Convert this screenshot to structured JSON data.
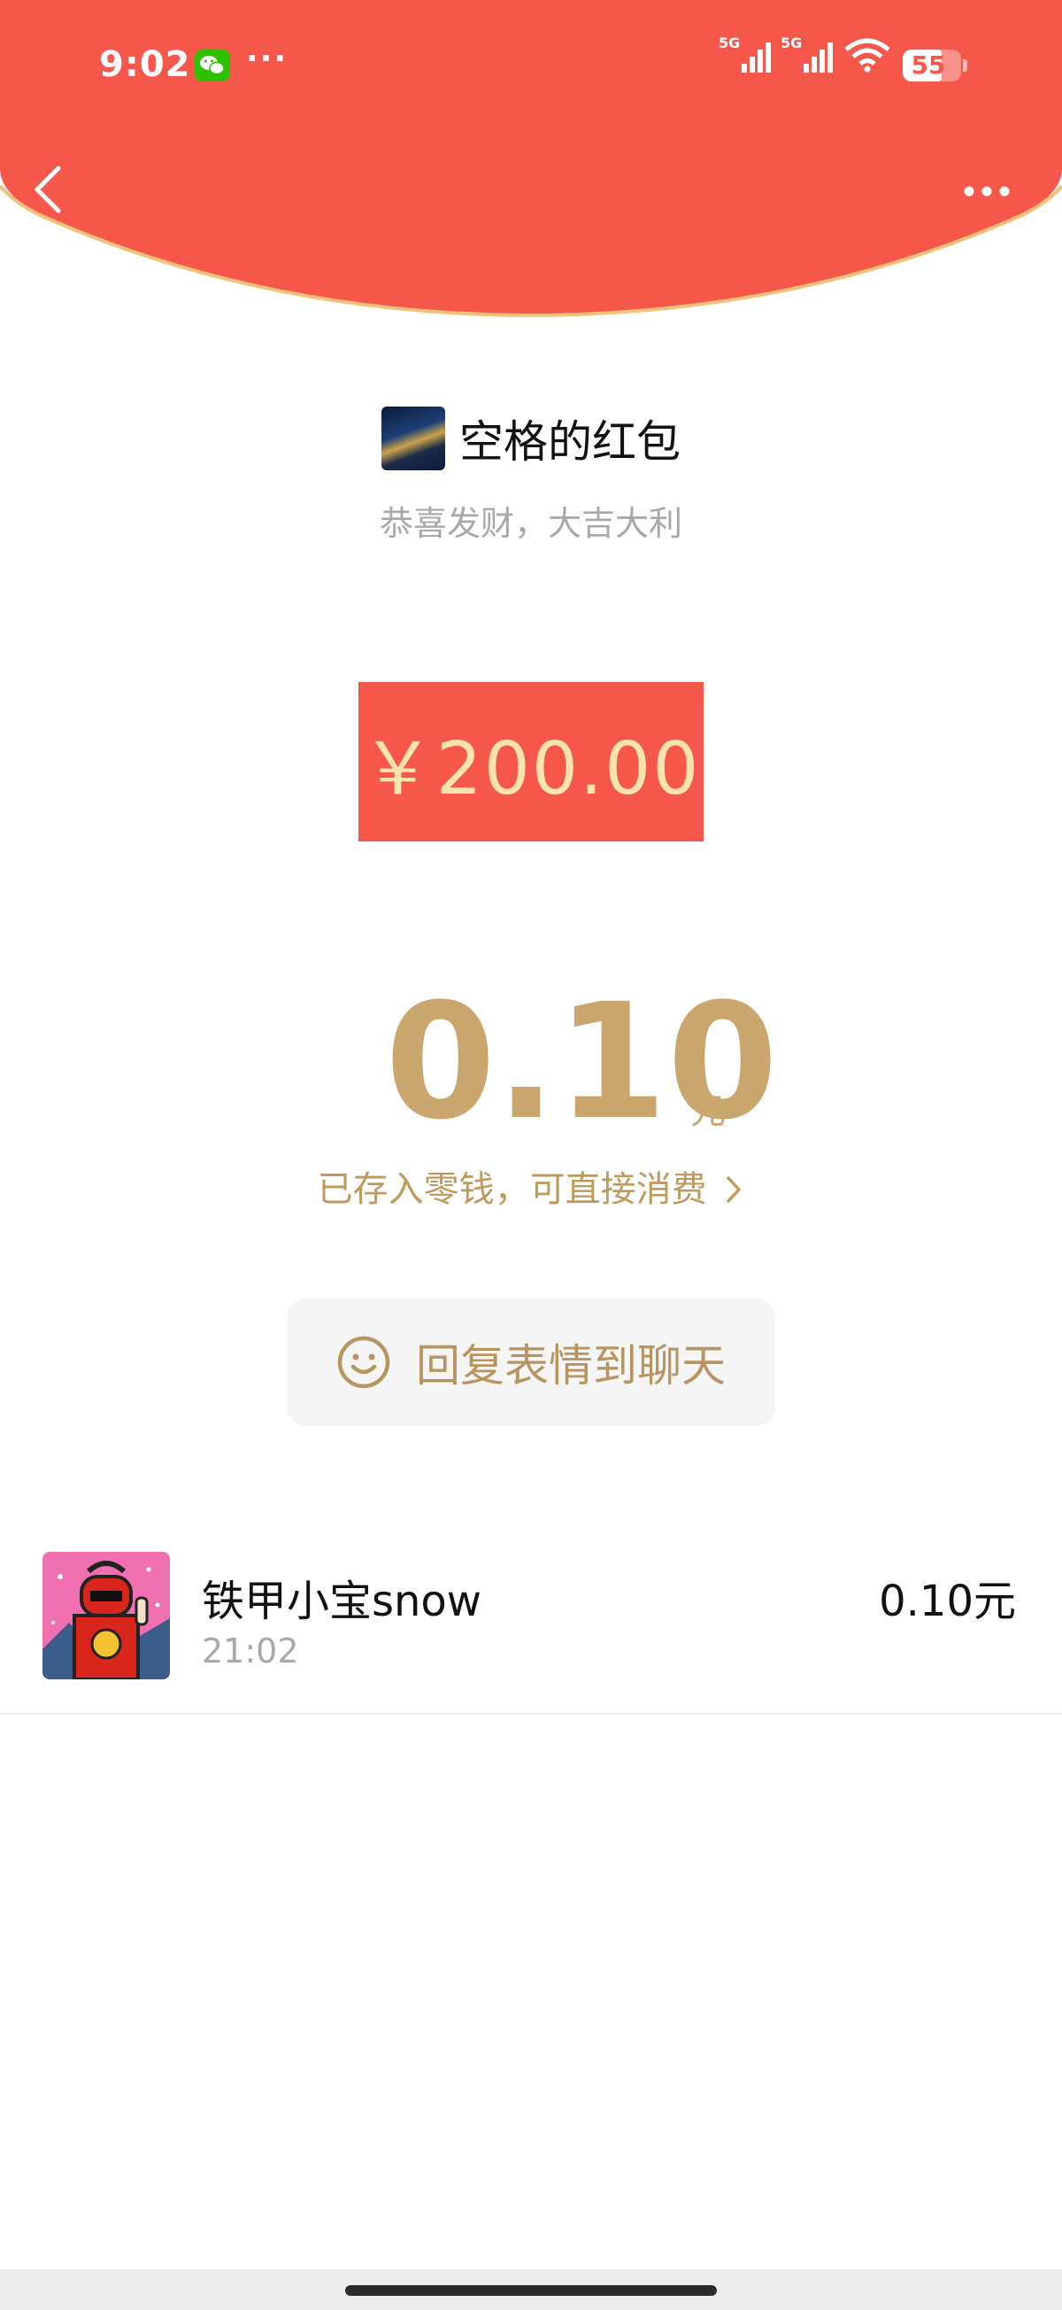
{
  "status_bar": {
    "time": "9:02",
    "overflow_dots": "···",
    "network_1": "5G",
    "network_2": "5G",
    "battery": "55",
    "wechat_icon": "wechat-icon",
    "wifi_icon": "wifi-icon"
  },
  "nav": {
    "back_icon": "chevron-left-icon",
    "menu_icon": "more-horizontal-icon"
  },
  "red_packet": {
    "title": "空格的红包",
    "blessing": "恭喜发财，大吉大利",
    "total_amount": "￥200.00",
    "received_amount": "0.10",
    "received_unit": "元",
    "stored_note": "已存入零钱，可直接消费",
    "reply_button": "回复表情到聊天"
  },
  "receivers": [
    {
      "name": "铁甲小宝snow",
      "time": "21:02",
      "amount": "0.10元"
    }
  ],
  "colors": {
    "header_red": "#f5574a",
    "header_rim": "#f3c27a",
    "gold": "#c9a66d",
    "amount_text": "#fbe3b0"
  }
}
